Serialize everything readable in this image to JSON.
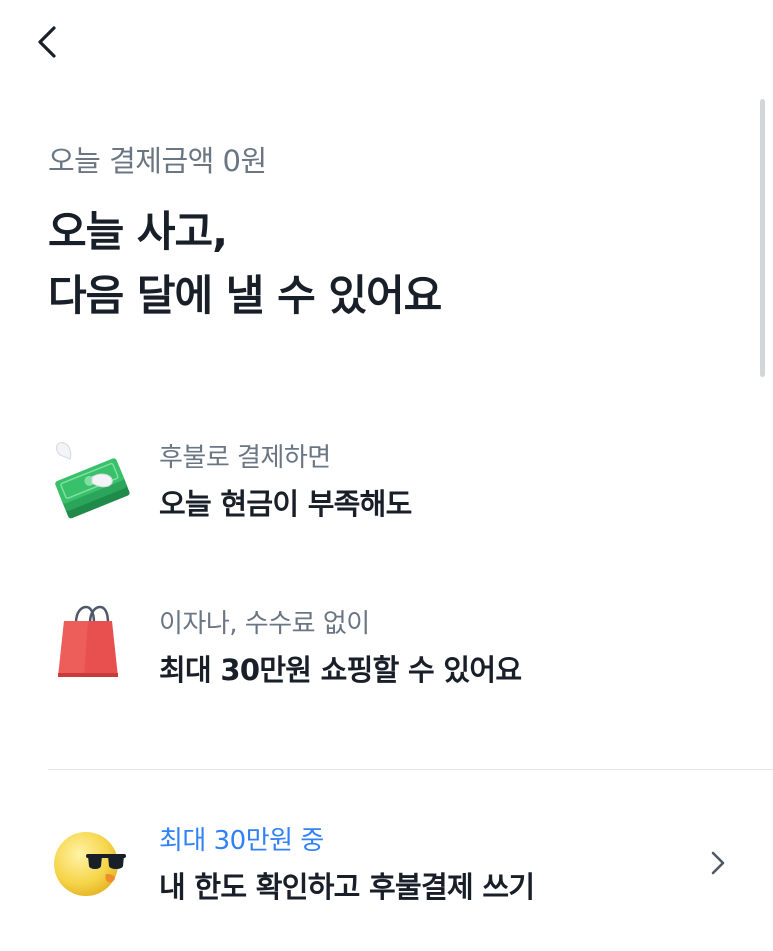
{
  "header": {
    "back_icon": "chevron-left-icon"
  },
  "intro": {
    "subtitle": "오늘 결제금액 0원",
    "headline_line1": "오늘 사고,",
    "headline_line2": "다음 달에 낼 수 있어요"
  },
  "benefits": [
    {
      "icon": "cash-with-wings-icon",
      "small": "후불로 결제하면",
      "big": "오늘 현금이 부족해도"
    },
    {
      "icon": "shopping-bag-icon",
      "small": "이자나, 수수료 없이",
      "big": "최대 30만원 쇼핑할 수 있어요"
    }
  ],
  "cta": {
    "icon": "sunglasses-chick-icon",
    "small": "최대 30만원 중",
    "big": "내 한도 확인하고 후불결제 쓰기",
    "chevron_icon": "chevron-right-icon"
  },
  "colors": {
    "text_primary": "#191f28",
    "text_secondary": "#6b7684",
    "accent": "#3182f6",
    "divider": "#e5e8eb"
  }
}
